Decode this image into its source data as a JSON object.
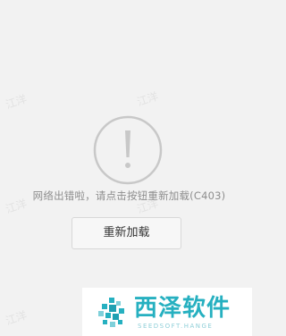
{
  "watermarks": [
    "江洋",
    "江洋",
    "江洋",
    "江洋",
    "江洋"
  ],
  "error": {
    "icon": "exclamation-circle-icon",
    "message": "网络出错啦，请点击按钮重新加载(C403)"
  },
  "actions": {
    "reload_label": "重新加载"
  },
  "branding": {
    "title": "西泽软件",
    "subtitle": "SEEDSOFT.HANGE",
    "accent_color": "#26b0c0"
  },
  "colors": {
    "background": "#f2f2f2",
    "icon_stroke": "#c8c8c8",
    "message_text": "#8e8e8e"
  }
}
